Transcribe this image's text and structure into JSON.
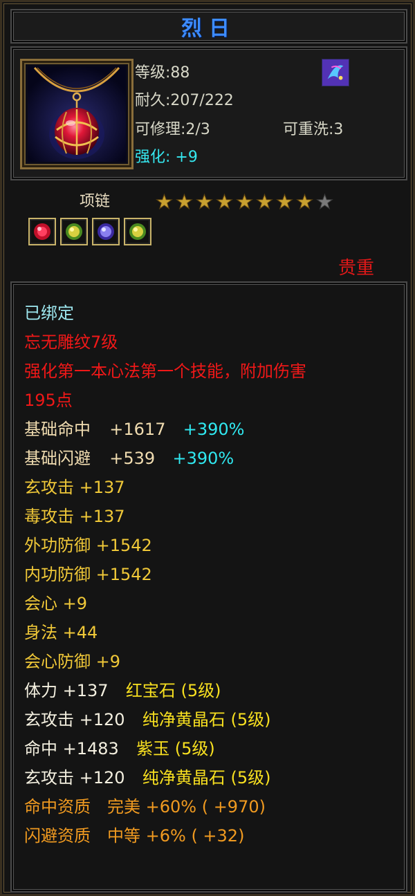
{
  "title": "烈日",
  "header": {
    "level_label": "等级:88",
    "durability_label": "耐久:207/222",
    "repairable_label": "可修理:2/3",
    "rewash_label": "可重洗:3",
    "enhance_label": "强化: +9"
  },
  "item_type": "项链",
  "stars": {
    "filled": 8,
    "total": 9
  },
  "gem_slots": [
    "red-gem-icon",
    "yellow-gem-icon",
    "purple-gem-icon",
    "yellow-gem-icon"
  ],
  "quality": "贵重",
  "details": {
    "bound": "已绑定",
    "engraving": "忘无雕纹7级",
    "effect_line1": "强化第一本心法第一个技能，附加伤害",
    "effect_line2": "195点",
    "attr1_name": "基础命中",
    "attr1_value": "+1617",
    "attr1_bonus": "+390%",
    "attr2_name": "基础闪避",
    "attr2_value": "+539",
    "attr2_bonus": "+390%",
    "stat1": "玄攻击 +137",
    "stat2": "毒攻击 +137",
    "stat3": "外功防御 +1542",
    "stat4": "内功防御 +1542",
    "stat5": "会心 +9",
    "stat6": "身法 +44",
    "stat7": "会心防御 +9",
    "gem1_stat": "体力 +137",
    "gem1_name": "红宝石 (5级)",
    "gem2_stat": "玄攻击 +120",
    "gem2_name": "纯净黄晶石 (5级)",
    "gem3_stat": "命中 +1483",
    "gem3_name": "紫玉 (5级)",
    "gem4_stat": "玄攻击 +120",
    "gem4_name": "纯净黄晶石 (5级)",
    "apt1": "命中资质　完美 +60% ( +970)",
    "apt2": "闪避资质　中等 +6% ( +32)"
  },
  "colors": {
    "title": "#3d8cff",
    "quality": "#e01818",
    "enhance": "#35e8f0",
    "star_filled": "#c8a030",
    "star_empty": "#7a7a7a"
  }
}
